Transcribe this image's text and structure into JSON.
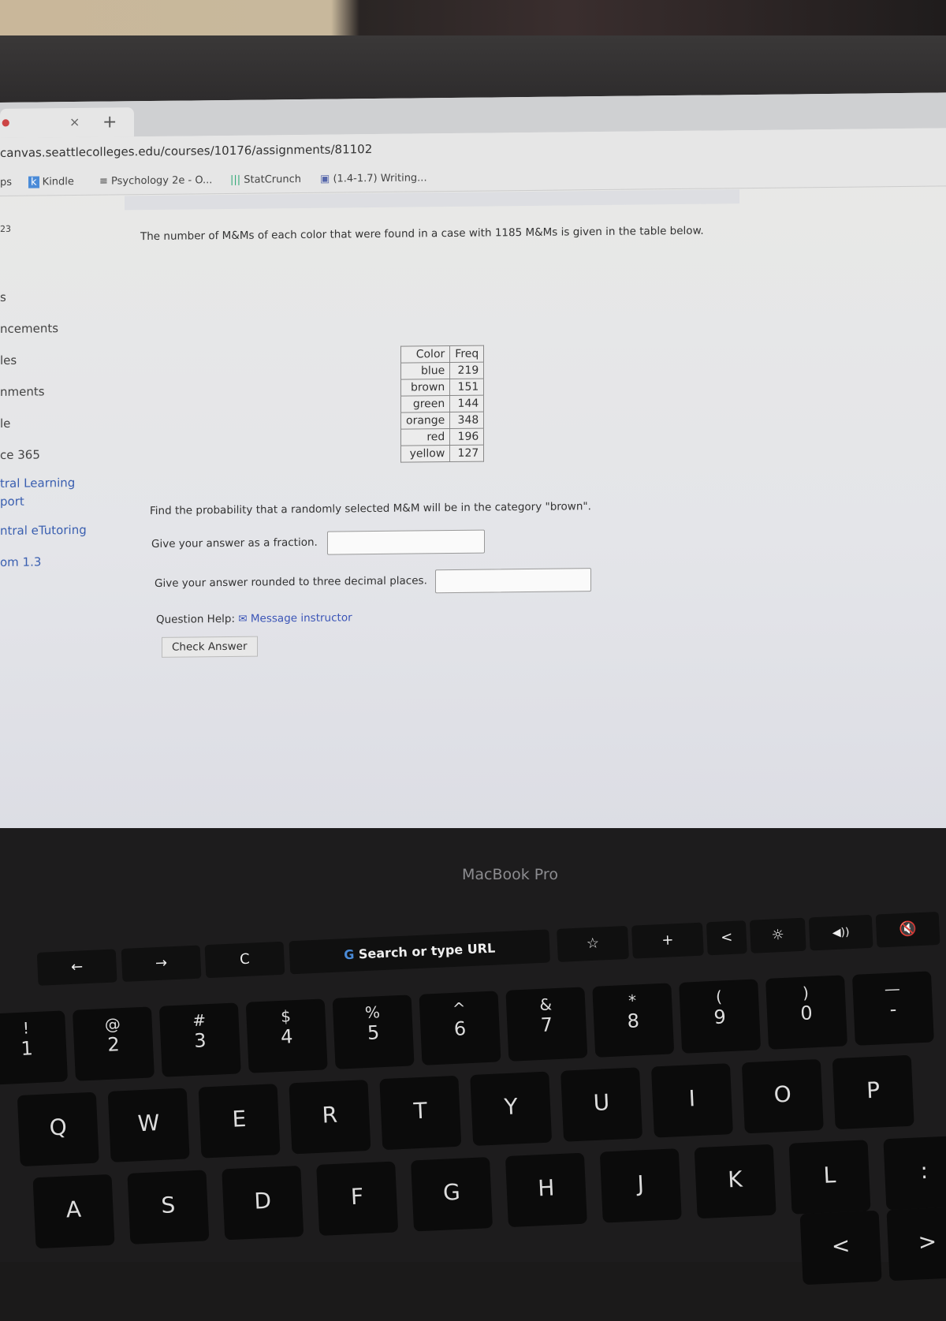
{
  "browser": {
    "tab_close": "×",
    "new_tab": "+",
    "url": "canvas.seattlecolleges.edu/courses/10176/assignments/81102",
    "bookmarks": [
      {
        "icon": "apps-icon",
        "label": "ps"
      },
      {
        "icon": "kindle-icon",
        "label": "Kindle"
      },
      {
        "icon": "book-icon",
        "label": "Psychology 2e - O..."
      },
      {
        "icon": "statcrunch-icon",
        "label": "StatCrunch"
      },
      {
        "icon": "doc-icon",
        "label": "(1.4-1.7) Writing..."
      }
    ]
  },
  "sidebar": {
    "items": [
      "23",
      "s",
      "ncements",
      "les",
      "nments",
      "le",
      "ce 365",
      "tral Learning",
      "port",
      "ntral eTutoring",
      "om 1.3"
    ]
  },
  "question": {
    "intro": "The number of M&Ms of each color that were found in a case with 1185 M&Ms is given in the table below.",
    "table": {
      "headers": [
        "Color",
        "Freq"
      ],
      "rows": [
        [
          "blue",
          "219"
        ],
        [
          "brown",
          "151"
        ],
        [
          "green",
          "144"
        ],
        [
          "orange",
          "348"
        ],
        [
          "red",
          "196"
        ],
        [
          "yellow",
          "127"
        ]
      ]
    },
    "prompt": "Find the probability that a randomly selected M&M will be in the category \"brown\".",
    "fraction_label": "Give your answer as a fraction.",
    "fraction_value": "",
    "decimal_label": "Give your answer rounded to three decimal places.",
    "decimal_value": "",
    "help_label": "Question Help:",
    "message_link": "Message instructor",
    "check_button": "Check Answer"
  },
  "laptop": {
    "brand": "MacBook Pro",
    "touchbar": {
      "back": "←",
      "forward": "→",
      "reload": "C",
      "search": "Search or type URL",
      "bookmark": "☆",
      "add": "+",
      "chevron": "<",
      "brightness": "☼",
      "volume": "◀))",
      "mute": "🔇"
    },
    "number_row": [
      [
        "!",
        "1"
      ],
      [
        "@",
        "2"
      ],
      [
        "#",
        "3"
      ],
      [
        "$",
        "4"
      ],
      [
        "%",
        "5"
      ],
      [
        "^",
        "6"
      ],
      [
        "&",
        "7"
      ],
      [
        "*",
        "8"
      ],
      [
        "(",
        "9"
      ],
      [
        ")",
        "0"
      ],
      [
        "—",
        "-"
      ]
    ],
    "qwerty": [
      "Q",
      "W",
      "E",
      "R",
      "T",
      "Y",
      "U",
      "I",
      "O",
      "P"
    ],
    "home": [
      "A",
      "S",
      "D",
      "F",
      "G",
      "H",
      "J",
      "K",
      "L",
      ":"
    ],
    "bottom": [
      "<",
      ">"
    ]
  }
}
